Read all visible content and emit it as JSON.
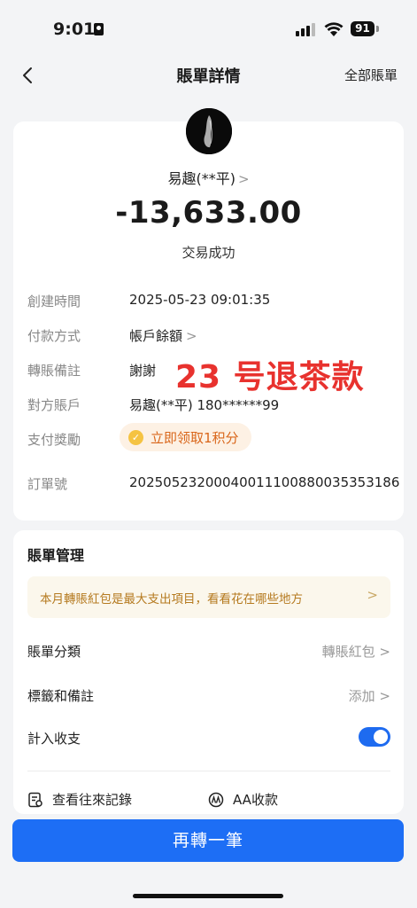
{
  "status_bar": {
    "time": "9:01",
    "battery": "91"
  },
  "nav": {
    "title": "賬單詳情",
    "right_link": "全部賬單"
  },
  "summary": {
    "payee": "易趣(**平)",
    "amount": "-13,633.00",
    "status": "交易成功"
  },
  "details": [
    {
      "label": "創建時間",
      "value": "2025-05-23 09:01:35"
    },
    {
      "label": "付款方式",
      "value": "帳戶餘額"
    },
    {
      "label": "轉賬備註",
      "value": "謝謝",
      "annotation": "23 号退茶款"
    },
    {
      "label": "對方賬戶",
      "value": "易趣(**平) 180******99"
    },
    {
      "label": "支付獎勵",
      "value": "立即领取1积分"
    },
    {
      "label": "訂單號",
      "value": "20250523200040011100880035353186"
    }
  ],
  "management": {
    "title": "賬單管理",
    "banner": "本月轉賬紅包是最大支出項目，看看花在哪些地方",
    "category": {
      "label": "賬單分類",
      "value": "轉賬紅包"
    },
    "tags": {
      "label": "標籤和備註",
      "value": "添加"
    },
    "include": {
      "label": "計入收支",
      "enabled": true
    },
    "links": {
      "history": "查看往來記錄",
      "aa": "AA收款"
    }
  },
  "cta": {
    "label": "再轉一筆"
  },
  "colors": {
    "accent": "#1d6ef5",
    "reward": "#d9661a",
    "annotation": "#e8322e"
  }
}
